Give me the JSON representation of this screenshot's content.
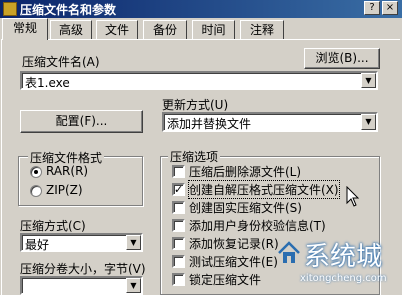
{
  "window": {
    "title": "压缩文件名和参数",
    "buttons": [
      "?",
      "×"
    ]
  },
  "tabs": [
    "常规",
    "高级",
    "文件",
    "备份",
    "时间",
    "注释"
  ],
  "archive_name": {
    "label": "压缩文件名(A)",
    "browse_button": "浏览(B)...",
    "value": "表1.exe"
  },
  "profiles_button": "配置(F)...",
  "update_mode": {
    "label": "更新方式(U)",
    "value": "添加并替换文件"
  },
  "archive_format": {
    "title": "压缩文件格式",
    "options": [
      "RAR(R)",
      "ZIP(Z)"
    ],
    "selected": "RAR(R)"
  },
  "compression_method": {
    "label": "压缩方式(C)",
    "value": "最好"
  },
  "split_volumes": {
    "label": "压缩分卷大小，字节(V)",
    "value": ""
  },
  "archive_options": {
    "title": "压缩选项",
    "items": [
      {
        "label": "压缩后删除源文件(L)",
        "checked": false
      },
      {
        "label": "创建自解压格式压缩文件(X)",
        "checked": true
      },
      {
        "label": "创建固实压缩文件(S)",
        "checked": false
      },
      {
        "label": "添加用户身份校验信息(T)",
        "checked": false
      },
      {
        "label": "添加恢复记录(R)",
        "checked": false
      },
      {
        "label": "测试压缩文件(E)",
        "checked": false
      },
      {
        "label": "锁定压缩文件",
        "checked": false
      }
    ]
  },
  "watermark": {
    "text": "系统城",
    "url": "xitongcheng.com"
  },
  "colors": {
    "face": "#d4d0c8",
    "title_start": "#0a246a",
    "title_end": "#3a6ea5",
    "watermark": "#2a6db0"
  }
}
